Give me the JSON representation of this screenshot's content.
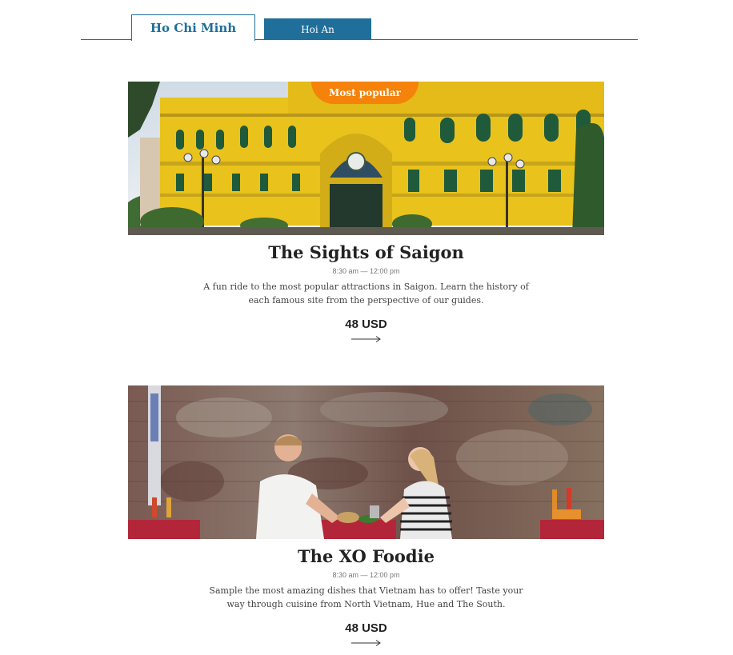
{
  "tabs": [
    {
      "label": "Ho Chi Minh",
      "active": true
    },
    {
      "label": "Hoi An",
      "active": false
    }
  ],
  "colors": {
    "accent": "#1f6f9a",
    "badge": "#f5820b",
    "text": "#222222"
  },
  "tours": [
    {
      "badge": "Most popular",
      "title": "The Sights of Saigon",
      "time": "8:30 am — 12:00 pm",
      "description": "A fun ride to the most popular attractions in Saigon. Learn the history of each famous site from the perspective of our guides.",
      "price": "48 USD",
      "arrow_icon": "arrow-right-icon",
      "image": "yellow colonial post office building"
    },
    {
      "title": "The XO Foodie",
      "time": "8:30 am — 12:00 pm",
      "description": "Sample the most amazing dishes that Vietnam has to offer! Taste your way through cuisine from North Vietnam, Hue and The South.",
      "price": "48 USD",
      "arrow_icon": "arrow-right-icon",
      "image": "couple eating street food by weathered wall"
    }
  ]
}
